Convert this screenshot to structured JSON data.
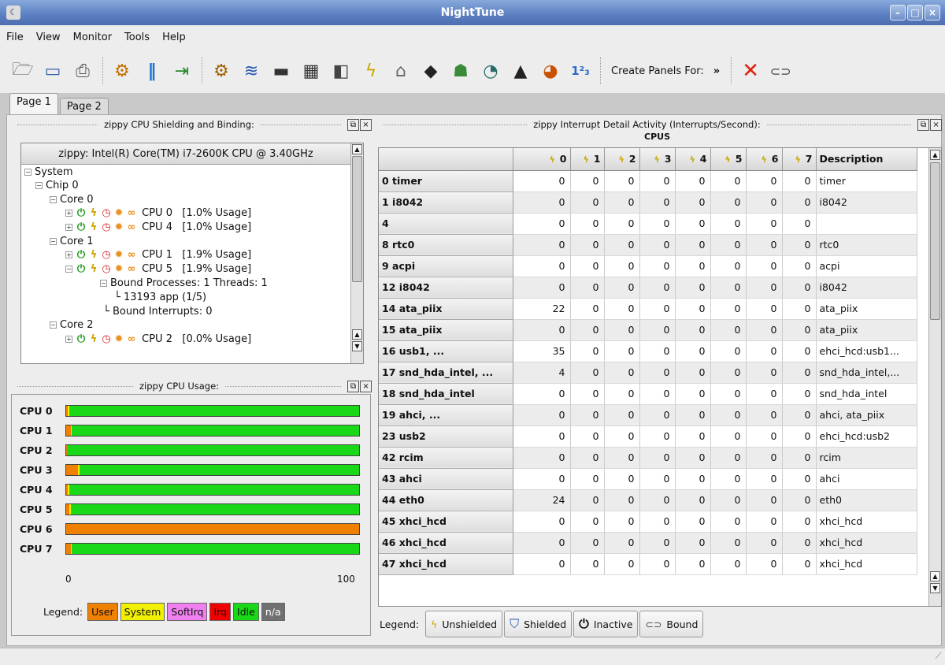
{
  "window": {
    "title": "NightTune",
    "app_icon": "nighttune-icon"
  },
  "menu": [
    "File",
    "View",
    "Monitor",
    "Tools",
    "Help"
  ],
  "toolbar": {
    "create_panels_label": "Create Panels For:",
    "overflow": "»"
  },
  "tabs": [
    "Page 1",
    "Page 2"
  ],
  "shielding_panel": {
    "title": "zippy CPU Shielding and Binding:",
    "header": "zippy: Intel(R) Core(TM) i7-2600K CPU @ 3.40GHz",
    "tree": {
      "system": "System",
      "chip": "Chip 0",
      "core0": "Core 0",
      "cpu0": "CPU 0",
      "cpu0_usage": "[1.0% Usage]",
      "cpu4": "CPU 4",
      "cpu4_usage": "[1.0% Usage]",
      "core1": "Core 1",
      "cpu1": "CPU 1",
      "cpu1_usage": "[1.9% Usage]",
      "cpu5": "CPU 5",
      "cpu5_usage": "[1.9% Usage]",
      "bound_processes": "Bound Processes: 1 Threads: 1",
      "process": "13193 app (1/5)",
      "bound_interrupts": "Bound Interrupts: 0",
      "core2": "Core 2",
      "cpu2": "CPU 2",
      "cpu2_usage": "[0.0% Usage]"
    }
  },
  "usage_panel": {
    "title": "zippy CPU Usage:",
    "cpus": [
      {
        "label": "CPU 0",
        "user": 0.5,
        "system": 0.5
      },
      {
        "label": "CPU 1",
        "user": 1.5,
        "system": 0.4
      },
      {
        "label": "CPU 2",
        "user": 0.2,
        "system": 0.2
      },
      {
        "label": "CPU 3",
        "user": 4.0,
        "system": 0.6
      },
      {
        "label": "CPU 4",
        "user": 0.5,
        "system": 0.5
      },
      {
        "label": "CPU 5",
        "user": 1.0,
        "system": 0.5
      },
      {
        "label": "CPU 6",
        "user": 100,
        "system": 0
      },
      {
        "label": "CPU 7",
        "user": 1.5,
        "system": 0.3
      }
    ],
    "scale_min": "0",
    "scale_max": "100",
    "legend_label": "Legend:",
    "legend": [
      {
        "label": "User",
        "color": "#f08000"
      },
      {
        "label": "System",
        "color": "#f0f000"
      },
      {
        "label": "SoftIrq",
        "color": "#f080f0"
      },
      {
        "label": "Irq",
        "color": "#f00000"
      },
      {
        "label": "Idle",
        "color": "#18d818"
      },
      {
        "label": "n/a",
        "color": "#707070"
      }
    ]
  },
  "interrupt_panel": {
    "title": "zippy Interrupt Detail Activity (Interrupts/Second):",
    "group_header": "CPUS",
    "columns": [
      "0",
      "1",
      "2",
      "3",
      "4",
      "5",
      "6",
      "7",
      "Description"
    ],
    "rows": [
      {
        "name": "0 timer",
        "values": [
          "0",
          "0",
          "0",
          "0",
          "0",
          "0",
          "0",
          "0"
        ],
        "desc": "timer"
      },
      {
        "name": "1 i8042",
        "values": [
          "0",
          "0",
          "0",
          "0",
          "0",
          "0",
          "0",
          "0"
        ],
        "desc": "i8042"
      },
      {
        "name": "4",
        "values": [
          "0",
          "0",
          "0",
          "0",
          "0",
          "0",
          "0",
          "0"
        ],
        "desc": ""
      },
      {
        "name": "8 rtc0",
        "values": [
          "0",
          "0",
          "0",
          "0",
          "0",
          "0",
          "0",
          "0"
        ],
        "desc": "rtc0"
      },
      {
        "name": "9 acpi",
        "values": [
          "0",
          "0",
          "0",
          "0",
          "0",
          "0",
          "0",
          "0"
        ],
        "desc": "acpi"
      },
      {
        "name": "12 i8042",
        "values": [
          "0",
          "0",
          "0",
          "0",
          "0",
          "0",
          "0",
          "0"
        ],
        "desc": "i8042"
      },
      {
        "name": "14 ata_piix",
        "values": [
          "22",
          "0",
          "0",
          "0",
          "0",
          "0",
          "0",
          "0"
        ],
        "desc": "ata_piix"
      },
      {
        "name": "15 ata_piix",
        "values": [
          "0",
          "0",
          "0",
          "0",
          "0",
          "0",
          "0",
          "0"
        ],
        "desc": "ata_piix"
      },
      {
        "name": "16 usb1, ...",
        "values": [
          "35",
          "0",
          "0",
          "0",
          "0",
          "0",
          "0",
          "0"
        ],
        "desc": "ehci_hcd:usb1..."
      },
      {
        "name": "17 snd_hda_intel, ...",
        "values": [
          "4",
          "0",
          "0",
          "0",
          "0",
          "0",
          "0",
          "0"
        ],
        "desc": "snd_hda_intel,..."
      },
      {
        "name": "18 snd_hda_intel",
        "values": [
          "0",
          "0",
          "0",
          "0",
          "0",
          "0",
          "0",
          "0"
        ],
        "desc": "snd_hda_intel"
      },
      {
        "name": "19 ahci, ...",
        "values": [
          "0",
          "0",
          "0",
          "0",
          "0",
          "0",
          "0",
          "0"
        ],
        "desc": "ahci, ata_piix"
      },
      {
        "name": "23 usb2",
        "values": [
          "0",
          "0",
          "0",
          "0",
          "0",
          "0",
          "0",
          "0"
        ],
        "desc": "ehci_hcd:usb2"
      },
      {
        "name": "42 rcim",
        "values": [
          "0",
          "0",
          "0",
          "0",
          "0",
          "0",
          "0",
          "0"
        ],
        "desc": "rcim"
      },
      {
        "name": "43 ahci",
        "values": [
          "0",
          "0",
          "0",
          "0",
          "0",
          "0",
          "0",
          "0"
        ],
        "desc": "ahci"
      },
      {
        "name": "44 eth0",
        "values": [
          "24",
          "0",
          "0",
          "0",
          "0",
          "0",
          "0",
          "0"
        ],
        "desc": "eth0"
      },
      {
        "name": "45 xhci_hcd",
        "values": [
          "0",
          "0",
          "0",
          "0",
          "0",
          "0",
          "0",
          "0"
        ],
        "desc": "xhci_hcd"
      },
      {
        "name": "46 xhci_hcd",
        "values": [
          "0",
          "0",
          "0",
          "0",
          "0",
          "0",
          "0",
          "0"
        ],
        "desc": "xhci_hcd"
      },
      {
        "name": "47 xhci_hcd",
        "values": [
          "0",
          "0",
          "0",
          "0",
          "0",
          "0",
          "0",
          "0"
        ],
        "desc": "xhci_hcd"
      }
    ],
    "legend_label": "Legend:",
    "legend": [
      "Unshielded",
      "Shielded",
      "Inactive",
      "Bound"
    ]
  }
}
